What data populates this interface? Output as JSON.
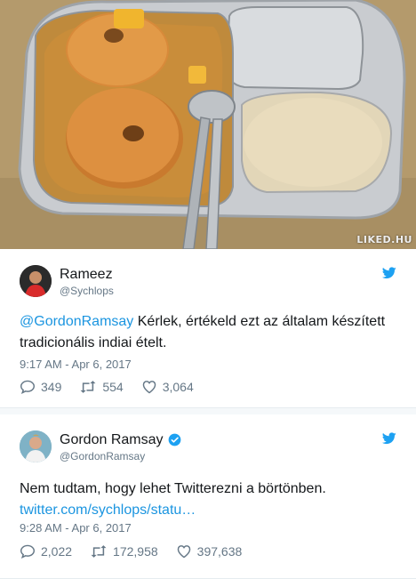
{
  "photo": {
    "watermark": "LIKED.HU"
  },
  "tweets": [
    {
      "name": "Rameez",
      "handle": "@Sychlops",
      "verified": false,
      "mention": "@GordonRamsay",
      "text": " Kérlek, értékeld ezt az általam készített tradicionális indiai ételt.",
      "time": "9:17 AM - Apr 6, 2017",
      "replies": "349",
      "retweets": "554",
      "likes": "3,064"
    },
    {
      "name": "Gordon Ramsay",
      "handle": "@GordonRamsay",
      "verified": true,
      "text": "Nem tudtam, hogy lehet Twitterezni a börtönben.",
      "link": "twitter.com/sychlops/statu…",
      "time": "9:28 AM - Apr 6, 2017",
      "replies": "2,022",
      "retweets": "172,958",
      "likes": "397,638"
    }
  ],
  "colors": {
    "accent": "#1da1f2",
    "link": "#1b95e0",
    "muted": "#657786",
    "text": "#14171a"
  }
}
